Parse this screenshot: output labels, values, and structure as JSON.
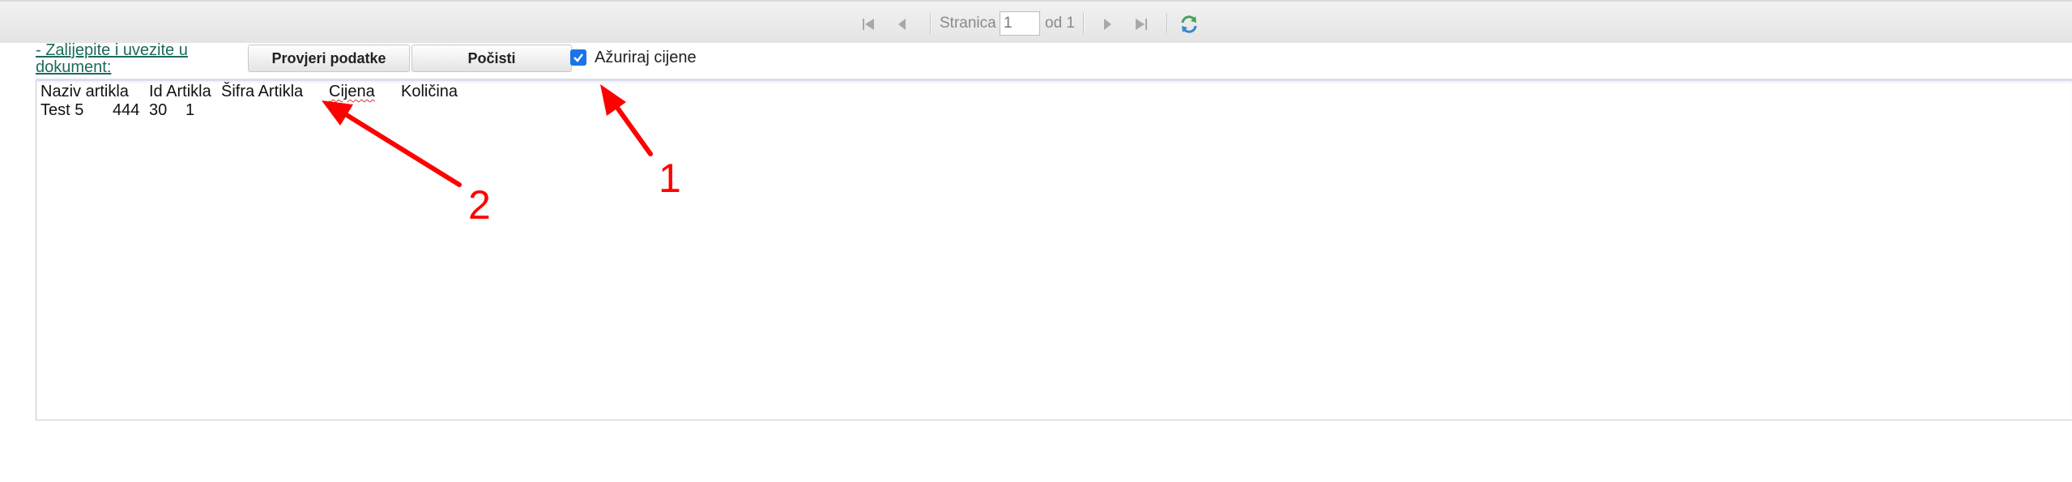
{
  "pager": {
    "page_label": "Stranica",
    "page_value": "1",
    "of_label": "od 1"
  },
  "toolbar": {
    "import_link": "- Zalijepite i uvezite u dokument:",
    "check_button": "Provjeri podatke",
    "clear_button": "Počisti",
    "update_prices_label": "Ažuriraj cijene",
    "update_prices_checked": true
  },
  "editor": {
    "headers": {
      "naziv": "Naziv artikla",
      "id": "Id Artikla",
      "sifra": "Šifra Artikla",
      "cijena": "Cijena",
      "kolicina": "Količina"
    },
    "row": {
      "naziv": "Test 5",
      "id": "444",
      "sifra": "30",
      "cijena": "1"
    }
  },
  "annotations": {
    "one": "1",
    "two": "2",
    "color": "#ff0000"
  }
}
